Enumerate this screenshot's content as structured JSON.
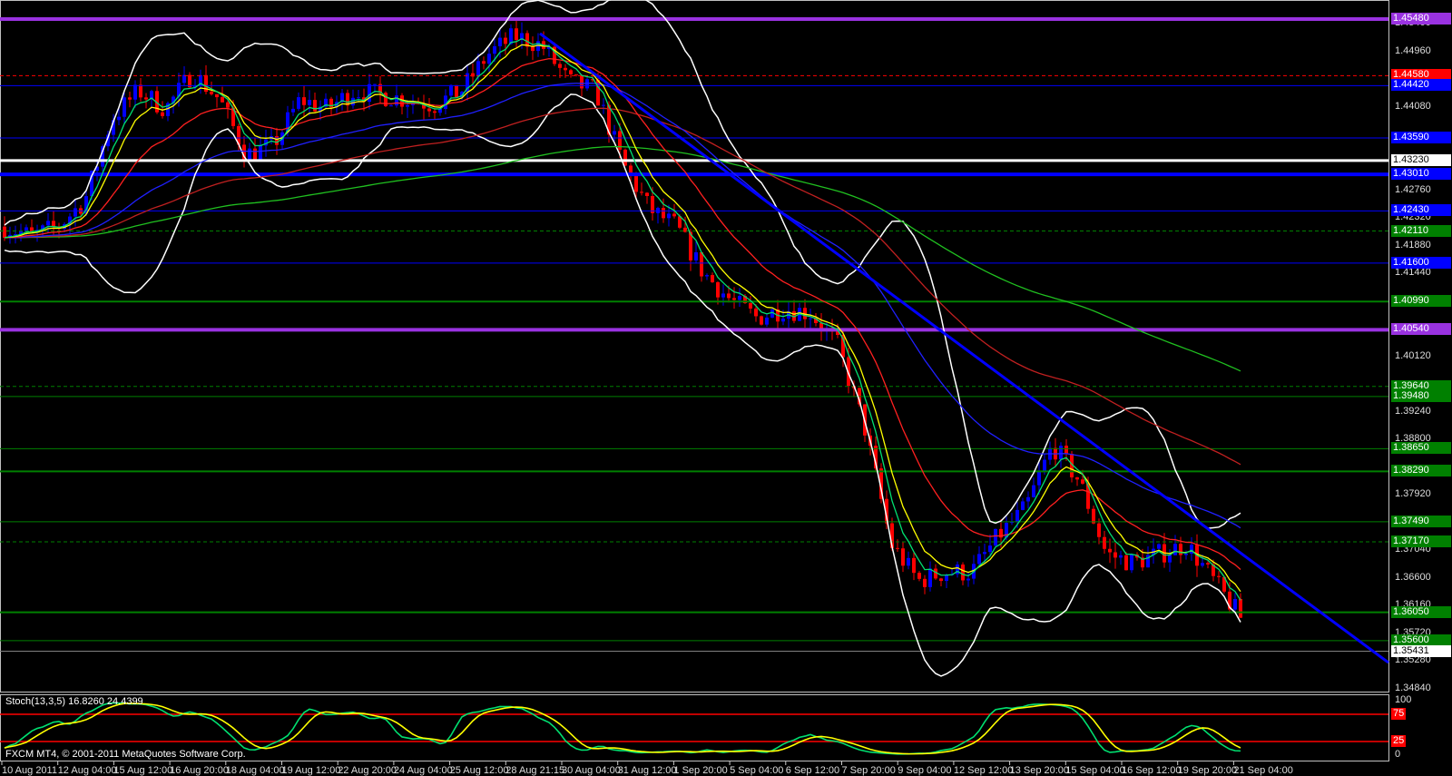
{
  "chart_data": {
    "type": "candlestick",
    "symbol_footer": "FXCM MT4, © 2001-2011 MetaQuotes Software Corp.",
    "price_range": [
      1.3484,
      1.4562
    ],
    "price_ticks": [
      "1.45400",
      "1.44960",
      "1.44080",
      "1.42760",
      "1.42320",
      "1.41880",
      "1.41440",
      "1.40120",
      "1.39240",
      "1.38800",
      "1.37920",
      "1.37040",
      "1.36600",
      "1.36160",
      "1.35720",
      "1.35280",
      "1.34840"
    ],
    "time_labels": [
      "10 Aug 2011",
      "12 Aug 04:00",
      "15 Aug 12:00",
      "16 Aug 20:00",
      "18 Aug 04:00",
      "19 Aug 12:00",
      "22 Aug 20:00",
      "24 Aug 04:00",
      "25 Aug 12:00",
      "28 Aug 21:15",
      "30 Aug 04:00",
      "31 Aug 12:00",
      "1 Sep 20:00",
      "5 Sep 04:00",
      "6 Sep 12:00",
      "7 Sep 20:00",
      "9 Sep 04:00",
      "12 Sep 12:00",
      "13 Sep 20:00",
      "15 Sep 04:00",
      "16 Sep 12:00",
      "19 Sep 20:00",
      "21 Sep 04:00"
    ],
    "close_path": [
      1.4218,
      1.4203,
      1.4218,
      1.4261,
      1.4391,
      1.4434,
      1.4405,
      1.4463,
      1.442,
      1.4333,
      1.4347,
      1.442,
      1.4405,
      1.4434,
      1.4427,
      1.442,
      1.4412,
      1.4434,
      1.4492,
      1.4521,
      1.4506,
      1.4448,
      1.4434,
      1.4319,
      1.4246,
      1.4218,
      1.4145,
      1.4102,
      1.4073,
      1.4088,
      1.4081,
      1.403,
      1.39,
      1.3713,
      1.3655,
      1.3669,
      1.3669,
      1.3727,
      1.377,
      1.3871,
      1.3814,
      1.3698,
      1.3684,
      1.3698,
      1.3713,
      1.3655,
      1.3597
    ],
    "levels": [
      {
        "price": "1.45480",
        "color": "#9932e0",
        "width": 4,
        "dash": false
      },
      {
        "price": "1.44580",
        "color": "#ff0000",
        "width": 1,
        "dash": true
      },
      {
        "price": "1.44420",
        "color": "#0000ff",
        "width": 1,
        "dash": false
      },
      {
        "price": "1.43590",
        "color": "#0000ff",
        "width": 1,
        "dash": false
      },
      {
        "price": "1.43230",
        "color": "#ffffff",
        "width": 3,
        "dash": false
      },
      {
        "price": "1.43010",
        "color": "#0000ff",
        "width": 4,
        "dash": false
      },
      {
        "price": "1.42430",
        "color": "#0000ff",
        "width": 1,
        "dash": false
      },
      {
        "price": "1.42110",
        "color": "#008000",
        "width": 1,
        "dash": true
      },
      {
        "price": "1.41600",
        "color": "#0000ff",
        "width": 1,
        "dash": false
      },
      {
        "price": "1.40990",
        "color": "#008000",
        "width": 2,
        "dash": false
      },
      {
        "price": "1.40540",
        "color": "#9932e0",
        "width": 4,
        "dash": false
      },
      {
        "price": "1.39640",
        "color": "#008000",
        "width": 1,
        "dash": true
      },
      {
        "price": "1.39480",
        "color": "#008000",
        "width": 1,
        "dash": false
      },
      {
        "price": "1.38650",
        "color": "#008000",
        "width": 1,
        "dash": false
      },
      {
        "price": "1.38290",
        "color": "#008000",
        "width": 2,
        "dash": false
      },
      {
        "price": "1.37490",
        "color": "#008000",
        "width": 1,
        "dash": false
      },
      {
        "price": "1.37170",
        "color": "#008000",
        "width": 1,
        "dash": true
      },
      {
        "price": "1.36050",
        "color": "#008000",
        "width": 2,
        "dash": false
      },
      {
        "price": "1.35600",
        "color": "#008000",
        "width": 1,
        "dash": false
      },
      {
        "price": "1.35431",
        "color": "#808080",
        "width": 1,
        "dash": false,
        "bid": true
      }
    ],
    "trendline": {
      "from_price": 1.4525,
      "to_price": 1.3525,
      "color": "#0000ff"
    },
    "moving_averages": [
      {
        "period": 5,
        "color": "#00e070"
      },
      {
        "period": 8,
        "color": "#ffff00"
      },
      {
        "period": 21,
        "color": "#ff2020"
      },
      {
        "period": 55,
        "color": "#2020ff"
      },
      {
        "period": 100,
        "color": "#c02020"
      },
      {
        "period": 200,
        "color": "#20c020"
      }
    ],
    "bollinger": {
      "period": 20,
      "deviation": 2,
      "color": "#ffffff"
    },
    "stochastic": {
      "label": "Stoch(13,3,5) 16.8260 24.4399",
      "levels": [
        "100",
        "75",
        "25",
        "0"
      ],
      "main_color": "#00e070",
      "signal_color": "#ffff00"
    }
  }
}
